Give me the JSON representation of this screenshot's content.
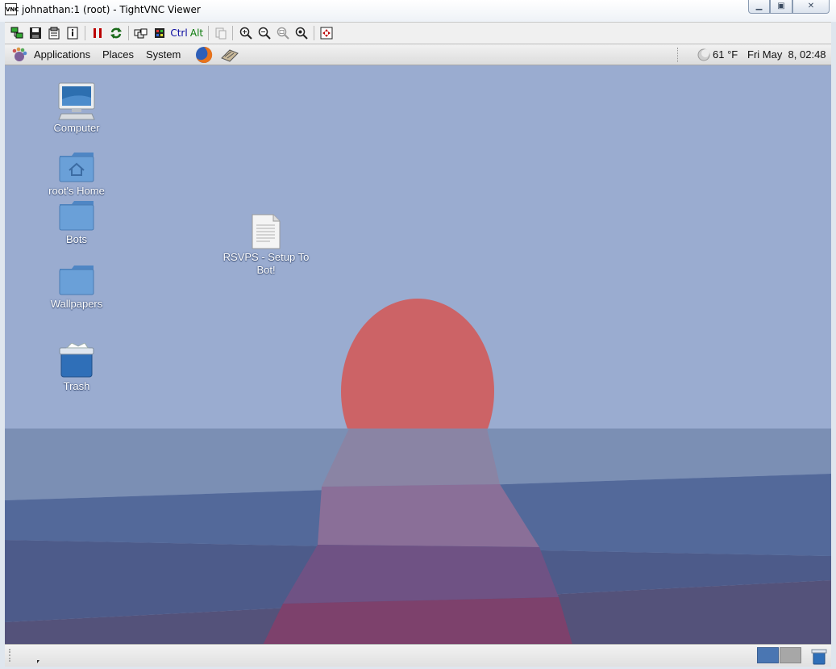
{
  "window": {
    "title": "johnathan:1 (root) - TightVNC Viewer",
    "app_icon_text": "VNC",
    "controls": {
      "minimize": "minimize-icon",
      "maximize": "maximize-icon",
      "close": "close-icon"
    }
  },
  "toolbar": {
    "buttons": [
      {
        "name": "new-connection-icon"
      },
      {
        "name": "save-icon"
      },
      {
        "name": "options-icon"
      },
      {
        "name": "connection-info-icon"
      },
      {
        "name": "pause-icon"
      },
      {
        "name": "refresh-icon"
      },
      {
        "name": "ctrl-alt-del-icon"
      },
      {
        "name": "send-ctrl-esc-icon"
      }
    ],
    "ctrl_label": "Ctrl",
    "alt_label": "Alt",
    "zoom_buttons": [
      "zoom-in-icon",
      "zoom-out-icon",
      "zoom-100-icon",
      "zoom-fit-icon"
    ]
  },
  "panel": {
    "applications": "Applications",
    "places": "Places",
    "system": "System",
    "weather": "61 °F",
    "clock": "Fri May  8, 02:48"
  },
  "desktop": {
    "icons": [
      {
        "label": "Computer"
      },
      {
        "label": "root's Home"
      },
      {
        "label": "Bots"
      },
      {
        "label": "Wallpapers"
      },
      {
        "label": "Trash"
      }
    ],
    "file": {
      "label": "RSVPS - Setup To Bot!"
    }
  },
  "colors": {
    "sky": "#9aacd0",
    "sun": "#cc6366",
    "folder": "#6aa0d8"
  }
}
